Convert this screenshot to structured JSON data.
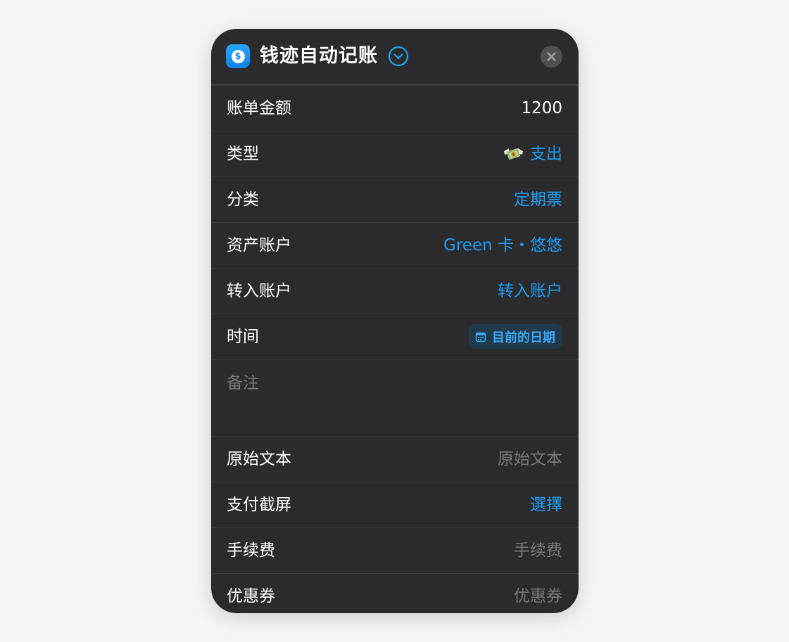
{
  "header": {
    "app_icon": "dollar-coin-icon",
    "title": "钱迹自动记账",
    "chevron_icon": "chevron-down-circle-icon",
    "close_icon": "close-icon"
  },
  "fields": {
    "amount": {
      "label": "账单金额",
      "value": "1200"
    },
    "type": {
      "label": "类型",
      "icon": "money-with-wings-icon",
      "value": "支出"
    },
    "category": {
      "label": "分类",
      "value": "定期票"
    },
    "asset_account": {
      "label": "资产账户",
      "value": "Green 卡・悠悠"
    },
    "transfer_account": {
      "label": "转入账户",
      "value": "转入账户"
    },
    "time": {
      "label": "时间",
      "icon": "calendar-icon",
      "value": "目前的日期"
    },
    "note": {
      "placeholder": "备注"
    },
    "original_text": {
      "label": "原始文本",
      "placeholder": "原始文本"
    },
    "screenshot": {
      "label": "支付截屏",
      "value": "選擇"
    },
    "fee": {
      "label": "手续费",
      "placeholder": "手续费"
    },
    "coupon": {
      "label": "优惠券",
      "placeholder": "优惠券"
    }
  },
  "colors": {
    "background": "#f3f5f7",
    "card": "#2b2b2d",
    "accent": "#1c9ef4",
    "placeholder": "#77777b",
    "text": "#ffffff"
  }
}
